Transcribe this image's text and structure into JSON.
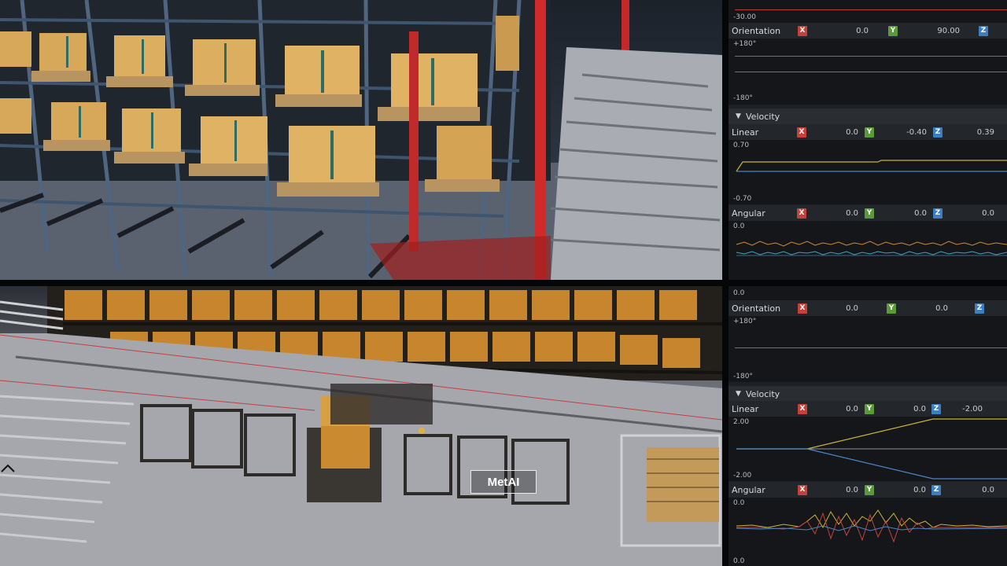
{
  "watermark": "MetAI",
  "panel_top": {
    "header_value": "-30.00",
    "orientation": {
      "label": "Orientation",
      "x": "0.0",
      "y": "90.00",
      "z": ""
    },
    "orientation_graph": {
      "max": "+180°",
      "min": "-180°"
    },
    "velocity_title": "Velocity",
    "linear": {
      "label": "Linear",
      "x": "0.0",
      "y": "-0.40",
      "z": "0.39"
    },
    "linear_graph": {
      "max": "0.70",
      "min": "-0.70"
    },
    "angular": {
      "label": "Angular",
      "x": "0.0",
      "y": "0.0",
      "z": "0.0"
    },
    "angular_graph": {
      "max": "0.0"
    }
  },
  "panel_bottom": {
    "header_value": "0.0",
    "orientation": {
      "label": "Orientation",
      "x": "0.0",
      "y": "0.0",
      "z": ""
    },
    "orientation_graph": {
      "max": "+180°",
      "min": "-180°"
    },
    "velocity_title": "Velocity",
    "linear": {
      "label": "Linear",
      "x": "0.0",
      "y": "0.0",
      "z": "-2.00"
    },
    "linear_graph": {
      "max": "2.00",
      "min": "-2.00"
    },
    "angular": {
      "label": "Angular",
      "x": "0.0",
      "y": "0.0",
      "z": "0.0"
    },
    "angular_graph": {
      "max": "0.0",
      "min": "0.0"
    }
  },
  "axis_letters": {
    "x": "X",
    "y": "Y",
    "z": "Z"
  },
  "colors": {
    "axis_x": "#c8403a",
    "axis_y": "#5b9a3c",
    "axis_z": "#3b7fc0",
    "trace_yellow": "#c9b43a",
    "trace_blue": "#4a86c8",
    "trace_red": "#c8403a",
    "trace_orange": "#d08a3a",
    "trace_cyan": "#4aa3b8"
  }
}
